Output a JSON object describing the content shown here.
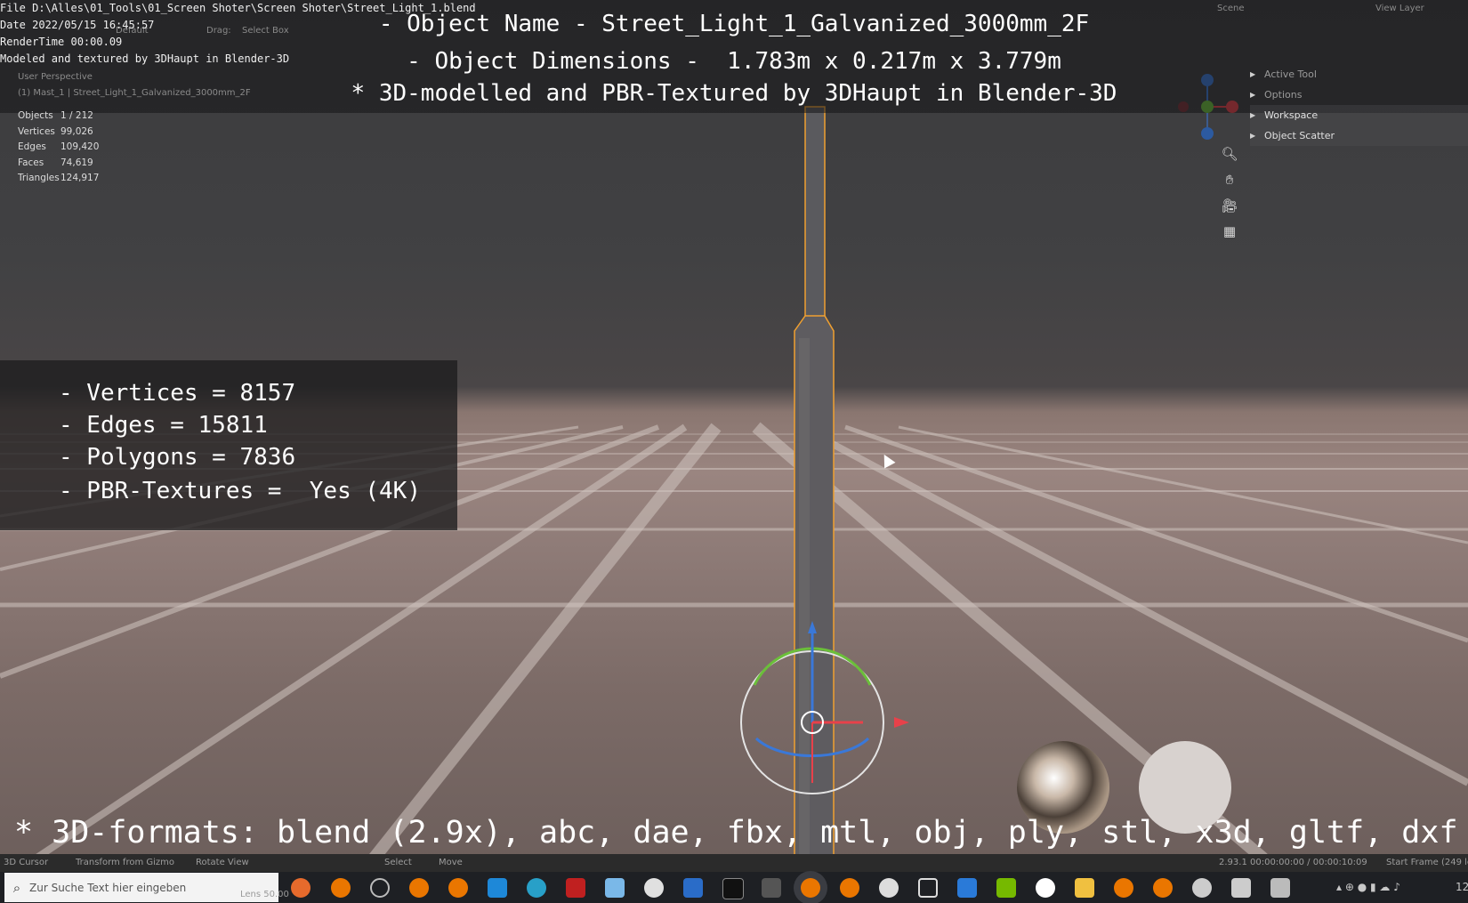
{
  "file_info": {
    "file_line": "File D:\\Alles\\01_Tools\\01_Screen Shoter\\Screen Shoter\\Street_Light_1.blend",
    "date_line": "Date 2022/05/15 16:45:57",
    "render_line": "RenderTime 00:00.09",
    "credit_line": "Modeled and textured by 3DHaupt in Blender-3D"
  },
  "headline": {
    "object_name": "- Object Name - Street_Light_1_Galvanized_3000mm_2F",
    "dimensions": "- Object Dimensions -  1.783m x 0.217m x 3.779m",
    "credit": "* 3D-modelled and PBR-Textured by 3DHaupt in Blender-3D"
  },
  "header_ghost": {
    "orientation": "Default",
    "drag_label": "Drag:",
    "drag_value": "Select Box",
    "scene": "Scene",
    "view_layer": "View Layer"
  },
  "viewport": {
    "perspective": "User Perspective",
    "collection": "(1) Mast_1 | Street_Light_1_Galvanized_3000mm_2F"
  },
  "stats": [
    {
      "label": "Objects",
      "value": "1 / 212"
    },
    {
      "label": "Vertices",
      "value": "99,026"
    },
    {
      "label": "Edges",
      "value": "109,420"
    },
    {
      "label": "Faces",
      "value": "74,619"
    },
    {
      "label": "Triangles",
      "value": "124,917"
    }
  ],
  "info_box": {
    "vertices": "- Vertices = 8157",
    "edges": "- Edges = 15811",
    "polygons": "- Polygons = 7836",
    "pbr": "- PBR-Textures =  Yes (4K)"
  },
  "side_panel": [
    {
      "label": "Active Tool",
      "active": false
    },
    {
      "label": "Options",
      "active": false
    },
    {
      "label": "Workspace",
      "active": true
    },
    {
      "label": "Object Scatter",
      "active": true
    }
  ],
  "formats_line": "* 3D-formats: blend (2.9x), abc, dae, fbx, mtl, obj, ply, stl, x3d, gltf, dxf",
  "status_bar": {
    "cursor": "3D Cursor",
    "gizmo": "Transform from Gizmo",
    "rotate": "Rotate View",
    "select": "Select",
    "move": "Move",
    "version_time": "2.93.1  00:00:00:00 / 00:00:10:09",
    "start_frame": "Start Frame (249 le",
    "lens": "Lens 50.00"
  },
  "taskbar": {
    "search_placeholder": "Zur Suche Text hier eingeben",
    "clock": "12:"
  },
  "colors": {
    "selection_outline": "#f0a030",
    "gizmo_x": "#e8414a",
    "gizmo_y": "#6bbf3a",
    "gizmo_z": "#3a78d8",
    "panel_bg": "#2b2b2b"
  }
}
